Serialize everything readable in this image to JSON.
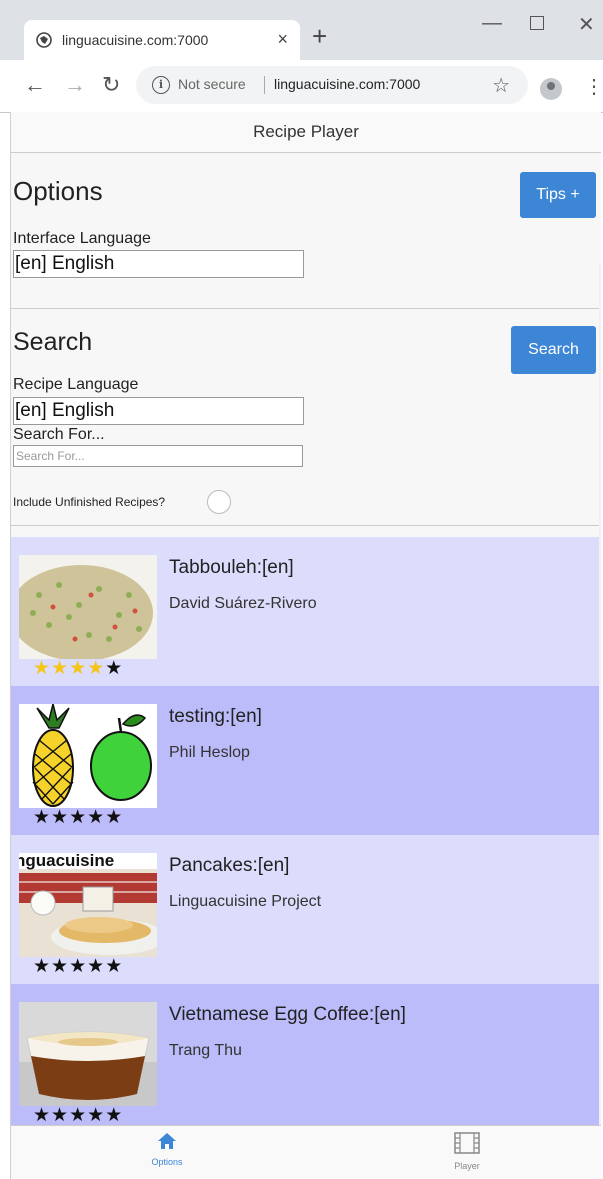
{
  "browser": {
    "tab_title": "linguacuisine.com:7000",
    "tab_close": "×",
    "new_tab": "+",
    "not_secure": "Not secure",
    "url": "linguacuisine.com:7000",
    "icons": [
      "globe-icon",
      "back-icon",
      "forward-icon",
      "reload-icon",
      "info-icon",
      "star-icon",
      "avatar-icon",
      "kebab-icon"
    ]
  },
  "app": {
    "header_title": "Recipe Player",
    "options": {
      "title": "Options",
      "tips_button": "Tips +",
      "interface_language_label": "Interface Language",
      "interface_language_value": "[en] English"
    },
    "search": {
      "title": "Search",
      "search_button": "Search",
      "recipe_language_label": "Recipe Language",
      "recipe_language_value": "[en] English",
      "search_for_label": "Search For...",
      "search_for_placeholder": "Search For...",
      "include_unfinished_label": "Include Unfinished Recipes?"
    },
    "recipes": [
      {
        "title": "Tabbouleh:[en]",
        "author": "David Suárez-Rivero",
        "rating": 4,
        "image": "tabbouleh-photo"
      },
      {
        "title": "testing:[en]",
        "author": "Phil Heslop",
        "rating": 0,
        "image": "pineapple-apple-illustration"
      },
      {
        "title": "Pancakes:[en]",
        "author": "Linguacuisine Project",
        "rating": 0,
        "image": "pancakes-photo",
        "image_text": "nguacuisine"
      },
      {
        "title": "Vietnamese Egg Coffee:[en]",
        "author": "Trang Thu",
        "rating": 0,
        "image": "egg-coffee-photo"
      }
    ],
    "bottom_nav": {
      "options_label": "Options",
      "player_label": "Player"
    },
    "colors": {
      "accent": "#3d86d6",
      "row_light": "#dcdcfc",
      "row_dark": "#bcbcfa",
      "star_on": "#f5c518"
    }
  }
}
